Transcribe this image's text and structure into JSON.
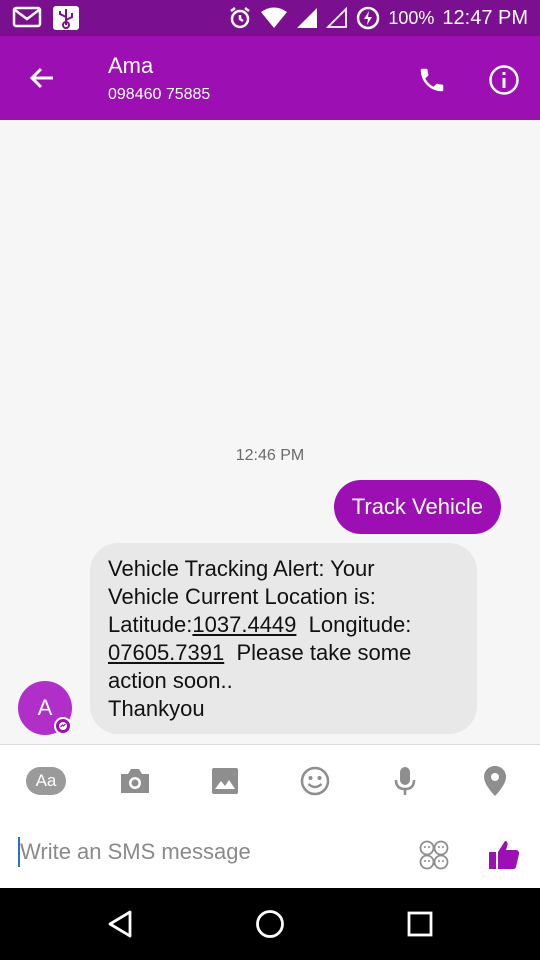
{
  "status_bar": {
    "battery": "100%",
    "time": "12:47 PM",
    "left_icons": [
      "mail-icon",
      "usb-icon"
    ],
    "right_icons": [
      "alarm-icon",
      "wifi-icon",
      "signal-icon",
      "signal-empty-icon",
      "battery-saver-icon"
    ]
  },
  "app_bar": {
    "contact_name": "Ama",
    "contact_number": "098460 75885"
  },
  "conversation": {
    "timestamp": "12:46 PM",
    "sent_message": "Track Vehicle",
    "received": {
      "line1": "Vehicle Tracking Alert: Your",
      "line2": "Vehicle Current Location is:",
      "latitude_label": "Latitude:",
      "latitude_value": "1037.4449",
      "longitude_label": "Longitude:",
      "longitude_value": "07605.7391",
      "line4_rest": "Please take some",
      "line5": "action soon..",
      "line6": "Thankyou"
    },
    "avatar_letter": "A"
  },
  "composer": {
    "aa_label": "Aa",
    "placeholder": "Write an SMS message",
    "value": ""
  },
  "colors": {
    "status_bar": "#7a0f8f",
    "app_bar": "#9b0fb3",
    "received_bubble": "#e8e8e8",
    "avatar": "#b12fc9",
    "nav_bar": "#000000"
  }
}
